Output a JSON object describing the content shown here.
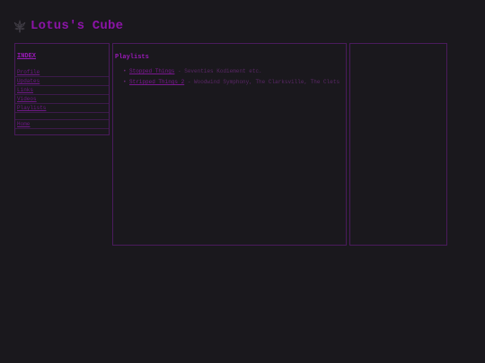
{
  "site": {
    "title": "Lotus's Cube",
    "logo_icon": "lotus-flower-icon"
  },
  "sidebar": {
    "heading": "INDEX",
    "items": [
      {
        "label": "Profile"
      },
      {
        "label": "Updates"
      },
      {
        "label": "Links"
      },
      {
        "label": "Videos"
      },
      {
        "label": "Playlists"
      }
    ],
    "bottom_item": "Home"
  },
  "main": {
    "heading": "Playlists",
    "entries": [
      {
        "link": "Stopped Things",
        "desc": "Seventies Kodiement etc."
      },
      {
        "link": "Stripped Things 2",
        "desc": "Woodwind Symphony, The Clarksville, The Clets"
      }
    ]
  },
  "colors": {
    "background": "#1a181d",
    "accent": "#8c14a8",
    "border": "#4a1b5c"
  }
}
